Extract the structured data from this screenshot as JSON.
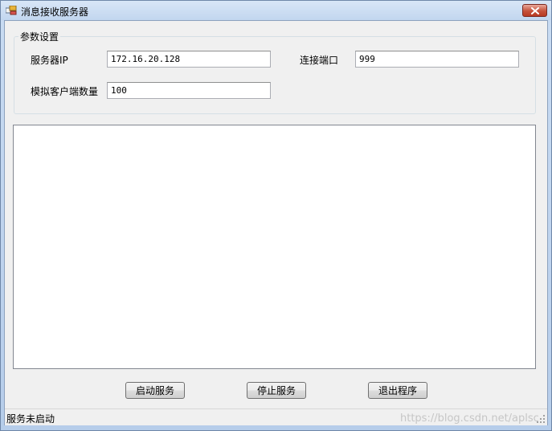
{
  "window": {
    "title": "消息接收服务器"
  },
  "settings": {
    "group_title": "参数设置",
    "server_ip_label": "服务器IP",
    "server_ip_value": "172.16.20.128",
    "port_label": "连接端口",
    "port_value": "999",
    "sim_clients_label": "模拟客户端数量",
    "sim_clients_value": "100"
  },
  "log": {
    "content": ""
  },
  "buttons": {
    "start": "启动服务",
    "stop": "停止服务",
    "exit": "退出程序"
  },
  "status": {
    "text": "服务未启动",
    "watermark": "https://blog.csdn.net/aplsc"
  },
  "icons": {
    "app": "app-window-icon",
    "close": "close-icon",
    "grip": "resize-grip-icon"
  },
  "colors": {
    "close_button": "#c5513b",
    "titlebar": "#c9dcf3",
    "client_bg": "#f0f0f0"
  }
}
